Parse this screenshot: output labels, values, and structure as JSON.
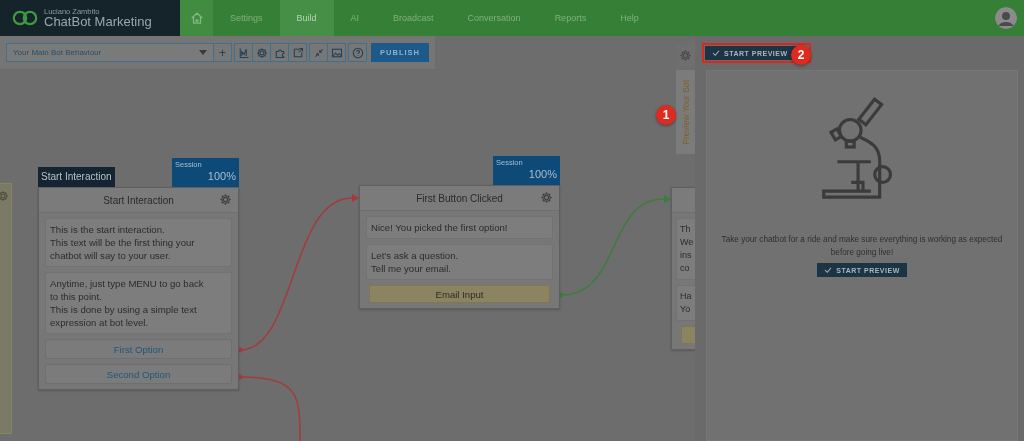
{
  "header": {
    "owner": "Luciano Zambito",
    "brand": "ChatBot Marketing",
    "nav": [
      {
        "kind": "home",
        "selected": false
      },
      {
        "label": "Settings",
        "selected": false
      },
      {
        "label": "Build",
        "selected": true
      },
      {
        "label": "AI",
        "selected": false
      },
      {
        "label": "Broadcast",
        "selected": false
      },
      {
        "label": "Conversation",
        "selected": false
      },
      {
        "label": "Reports",
        "selected": false
      },
      {
        "label": "Help",
        "selected": false
      }
    ]
  },
  "toolbar": {
    "behaviour": "Your Main Bot Behaviour",
    "buttons": [
      {
        "kind": "add",
        "label": "+"
      },
      {
        "kind": "chart"
      },
      {
        "kind": "gear"
      },
      {
        "kind": "puzzle"
      },
      {
        "kind": "export"
      },
      {
        "kind": "collapse"
      },
      {
        "kind": "image"
      },
      {
        "kind": "help"
      }
    ],
    "publish": "PUBLISH"
  },
  "nodes": [
    {
      "kind": "note"
    },
    {
      "kind": "flow",
      "tab": "Start Interaction",
      "session": {
        "label": "Session",
        "value": "100%"
      },
      "title": "Start Interaction",
      "messages": [
        "This is the start interaction.\nThis text will be the first thing your\nchatbot will say to your user.",
        "Anytime, just type MENU to go back\nto this point.\nThis is done by using a simple text\nexpression at bot level."
      ],
      "options": [
        {
          "kind": "button",
          "label": "First Option"
        },
        {
          "kind": "button",
          "label": "Second Option"
        }
      ]
    },
    {
      "kind": "flow",
      "session": {
        "label": "Session",
        "value": "100%"
      },
      "title": "First Button Clicked",
      "messages": [
        "Nice! You picked the first option!",
        "Let's ask a question.\nTell me your email."
      ],
      "options": [
        {
          "kind": "input",
          "label": "Email Input"
        }
      ]
    },
    {
      "kind": "flow",
      "messages": [
        "Th\nWe\nins\nco",
        "Ha\nYo"
      ],
      "options": [
        {
          "kind": "input"
        }
      ]
    }
  ],
  "connectors": [
    {
      "color": "#a33b3b"
    },
    {
      "color": "#a33b3b"
    },
    {
      "color": "#3c7d3c"
    }
  ],
  "preview": {
    "tabs": [
      {
        "kind": "settings",
        "selected": false
      },
      {
        "kind": "label",
        "label": "Preview Your Bot",
        "selected": true
      }
    ],
    "start": "START PREVIEW",
    "message": "Take your chatbot for a ride and make sure everything is working as expected before going live!",
    "button": "START PREVIEW"
  },
  "annotations": [
    {
      "label": "1"
    },
    {
      "label": "2"
    }
  ]
}
